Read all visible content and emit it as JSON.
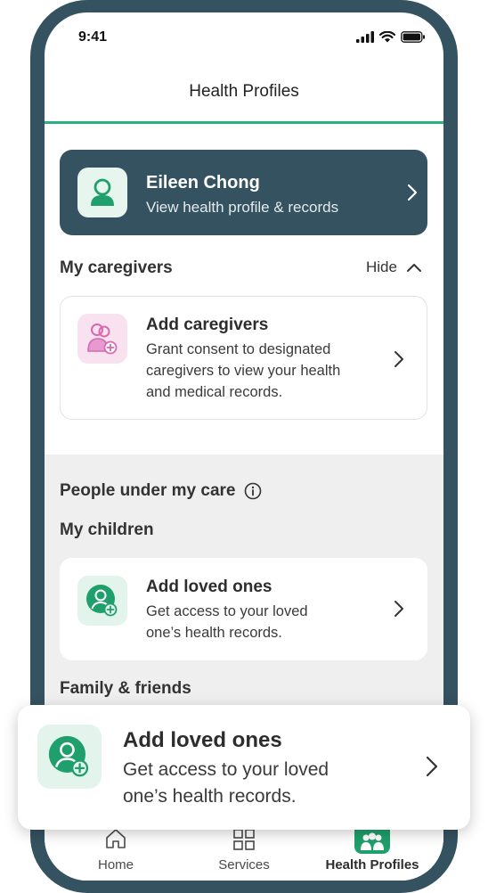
{
  "status_bar": {
    "time": "9:41"
  },
  "header": {
    "title": "Health Profiles"
  },
  "profile": {
    "name": "Eileen Chong",
    "subtitle": "View health profile & records"
  },
  "caregivers": {
    "section_title": "My caregivers",
    "toggle_label": "Hide",
    "card": {
      "title": "Add caregivers",
      "description_lines": [
        "Grant consent to designated",
        "caregivers to view your health",
        "and medical records."
      ]
    }
  },
  "people_under_care": {
    "section_title": "People under my care",
    "children": {
      "title": "My children",
      "card": {
        "title": "Add loved ones",
        "description_lines": [
          "Get access to your loved",
          "one’s health records."
        ]
      }
    },
    "family": {
      "title": "Family & friends"
    }
  },
  "floating_card": {
    "title": "Add loved ones",
    "description_lines": [
      "Get access to your loved",
      "one’s health records."
    ]
  },
  "tabbar": {
    "items": [
      {
        "label": "Home",
        "icon": "home-icon",
        "active": false
      },
      {
        "label": "Services",
        "icon": "grid-icon",
        "active": false
      },
      {
        "label": "Health Profiles",
        "icon": "family-icon",
        "active": true
      }
    ]
  },
  "colors": {
    "frame": "#355260",
    "accent": "#2bb07f",
    "icon_green": "#1f9f6c",
    "caregiver_pink": "#d968b0"
  }
}
